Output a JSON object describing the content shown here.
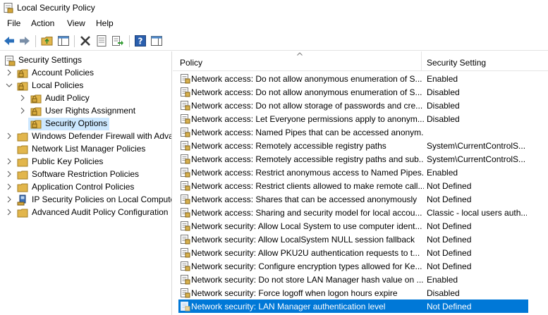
{
  "window": {
    "title": "Local Security Policy"
  },
  "menu": [
    "File",
    "Action",
    "View",
    "Help"
  ],
  "toolbar": {
    "buttons": [
      "back-icon",
      "forward-icon",
      "up-folder-icon",
      "show-hide-tree-icon",
      "delete-icon",
      "properties-icon",
      "export-list-icon",
      "help-icon",
      "show-action-pane-icon"
    ]
  },
  "tree": [
    {
      "label": "Security Settings",
      "expanded": true
    },
    {
      "label": "Account Policies",
      "expanded": false
    },
    {
      "label": "Local Policies",
      "expanded": true
    },
    {
      "label": "Audit Policy",
      "expanded": false
    },
    {
      "label": "User Rights Assignment",
      "expanded": false
    },
    {
      "label": "Security Options",
      "selected": true
    },
    {
      "label": "Windows Defender Firewall with Adva",
      "expanded": false
    },
    {
      "label": "Network List Manager Policies"
    },
    {
      "label": "Public Key Policies",
      "expanded": false
    },
    {
      "label": "Software Restriction Policies",
      "expanded": false
    },
    {
      "label": "Application Control Policies",
      "expanded": false
    },
    {
      "label": "IP Security Policies on Local Compute",
      "expanded": false
    },
    {
      "label": "Advanced Audit Policy Configuration",
      "expanded": false
    }
  ],
  "list": {
    "columns": [
      "Policy",
      "Security Setting"
    ],
    "rows": [
      {
        "policy": "Network access: Do not allow anonymous enumeration of S...",
        "setting": "Enabled"
      },
      {
        "policy": "Network access: Do not allow anonymous enumeration of S...",
        "setting": "Disabled"
      },
      {
        "policy": "Network access: Do not allow storage of passwords and cre...",
        "setting": "Disabled"
      },
      {
        "policy": "Network access: Let Everyone permissions apply to anonym...",
        "setting": "Disabled"
      },
      {
        "policy": "Network access: Named Pipes that can be accessed anonym...",
        "setting": ""
      },
      {
        "policy": "Network access: Remotely accessible registry paths",
        "setting": "System\\CurrentControlS..."
      },
      {
        "policy": "Network access: Remotely accessible registry paths and sub...",
        "setting": "System\\CurrentControlS..."
      },
      {
        "policy": "Network access: Restrict anonymous access to Named Pipes...",
        "setting": "Enabled"
      },
      {
        "policy": "Network access: Restrict clients allowed to make remote call...",
        "setting": "Not Defined"
      },
      {
        "policy": "Network access: Shares that can be accessed anonymously",
        "setting": "Not Defined"
      },
      {
        "policy": "Network access: Sharing and security model for local accou...",
        "setting": "Classic - local users auth..."
      },
      {
        "policy": "Network security: Allow Local System to use computer ident...",
        "setting": "Not Defined"
      },
      {
        "policy": "Network security: Allow LocalSystem NULL session fallback",
        "setting": "Not Defined"
      },
      {
        "policy": "Network security: Allow PKU2U authentication requests to t...",
        "setting": "Not Defined"
      },
      {
        "policy": "Network security: Configure encryption types allowed for Ke...",
        "setting": "Not Defined"
      },
      {
        "policy": "Network security: Do not store LAN Manager hash value on ...",
        "setting": "Enabled"
      },
      {
        "policy": "Network security: Force logoff when logon hours expire",
        "setting": "Disabled"
      },
      {
        "policy": "Network security: LAN Manager authentication level",
        "setting": "Not Defined",
        "selected": true
      }
    ]
  },
  "colors": {
    "selection": "#0078d7",
    "tree_selection": "#cde8ff",
    "folder": "#dcb14a"
  }
}
